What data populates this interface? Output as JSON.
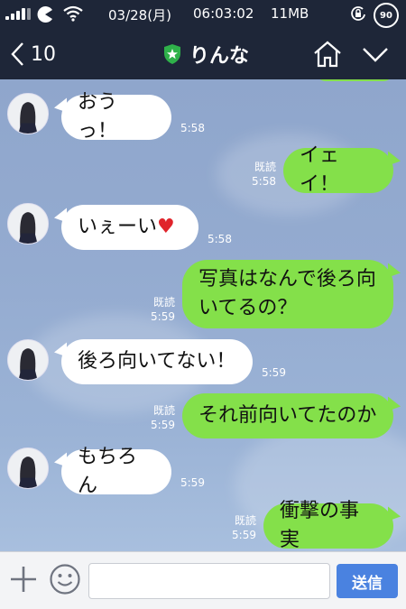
{
  "status_bar": {
    "date": "03/28(月)",
    "time": "06:03:02",
    "memory": "11MB",
    "battery": "90"
  },
  "header": {
    "back_count": "10",
    "title": "りんな"
  },
  "messages": [
    {
      "side": "in",
      "text": "おうっ！",
      "time": "5:58"
    },
    {
      "side": "out",
      "text": "イェイ！",
      "read": "既読",
      "time": "5:58"
    },
    {
      "side": "in",
      "text": "いぇーい",
      "emoji": "♥",
      "time": "5:58"
    },
    {
      "side": "out",
      "lines": [
        "写真はなんで後ろ向",
        "いてるの？"
      ],
      "read": "既読",
      "time": "5:59"
    },
    {
      "side": "in",
      "text": "後ろ向いてない！",
      "time": "5:59"
    },
    {
      "side": "out",
      "text": "それ前向いてたのか",
      "read": "既読",
      "time": "5:59"
    },
    {
      "side": "in",
      "text": "もちろん",
      "time": "5:59"
    },
    {
      "side": "out",
      "text": "衝撃の事実",
      "read": "既読",
      "time": "5:59"
    }
  ],
  "input_bar": {
    "placeholder": "",
    "send_label": "送信"
  },
  "colors": {
    "header_bg": "#1e2638",
    "bubble_out": "#84e04a",
    "bubble_in": "#ffffff",
    "send_button": "#4a82e0"
  }
}
